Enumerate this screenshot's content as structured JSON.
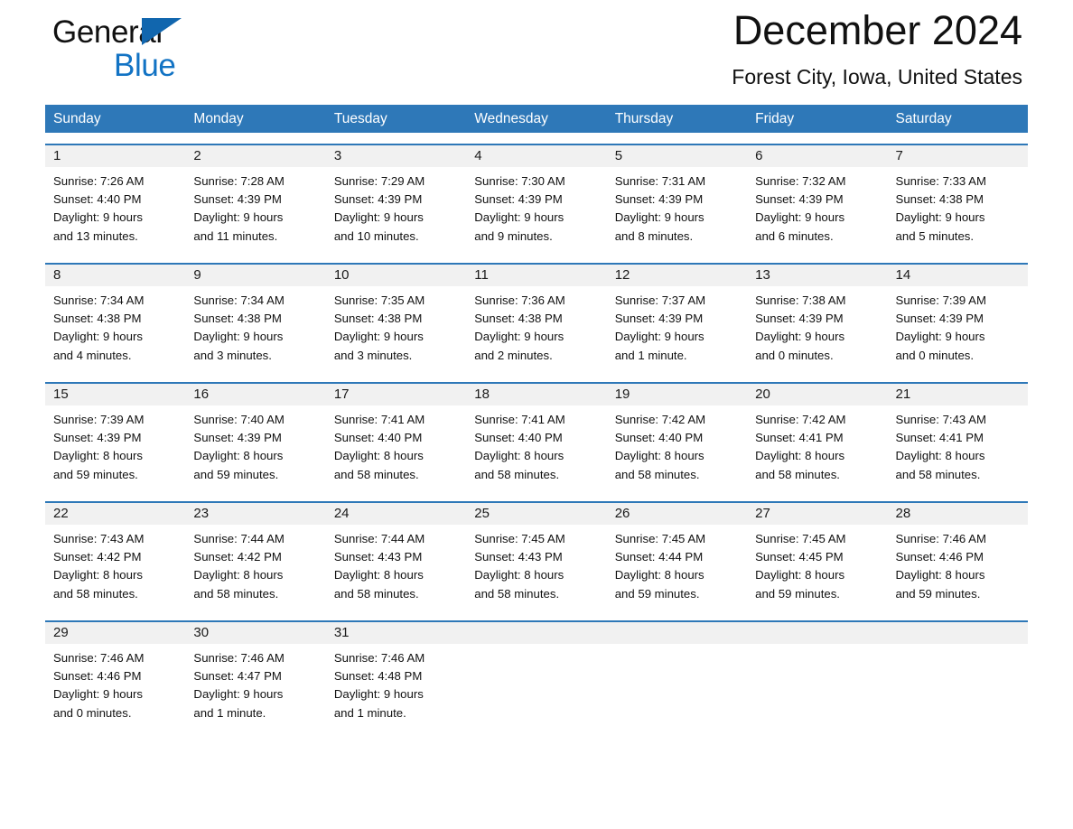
{
  "brand": {
    "line1": "General",
    "line2": "Blue",
    "accent_color": "#1273c4",
    "triangle_color": "#1166ae"
  },
  "header": {
    "title": "December 2024",
    "location": "Forest City, Iowa, United States"
  },
  "theme": {
    "header_blue": "#2e78b8",
    "daynum_band": "#f1f1f1",
    "text": "#111111"
  },
  "calendar": {
    "weekday_headers": [
      "Sunday",
      "Monday",
      "Tuesday",
      "Wednesday",
      "Thursday",
      "Friday",
      "Saturday"
    ],
    "weeks": [
      [
        {
          "day": "1",
          "sunrise": "Sunrise: 7:26 AM",
          "sunset": "Sunset: 4:40 PM",
          "daylight_1": "Daylight: 9 hours",
          "daylight_2": "and 13 minutes."
        },
        {
          "day": "2",
          "sunrise": "Sunrise: 7:28 AM",
          "sunset": "Sunset: 4:39 PM",
          "daylight_1": "Daylight: 9 hours",
          "daylight_2": "and 11 minutes."
        },
        {
          "day": "3",
          "sunrise": "Sunrise: 7:29 AM",
          "sunset": "Sunset: 4:39 PM",
          "daylight_1": "Daylight: 9 hours",
          "daylight_2": "and 10 minutes."
        },
        {
          "day": "4",
          "sunrise": "Sunrise: 7:30 AM",
          "sunset": "Sunset: 4:39 PM",
          "daylight_1": "Daylight: 9 hours",
          "daylight_2": "and 9 minutes."
        },
        {
          "day": "5",
          "sunrise": "Sunrise: 7:31 AM",
          "sunset": "Sunset: 4:39 PM",
          "daylight_1": "Daylight: 9 hours",
          "daylight_2": "and 8 minutes."
        },
        {
          "day": "6",
          "sunrise": "Sunrise: 7:32 AM",
          "sunset": "Sunset: 4:39 PM",
          "daylight_1": "Daylight: 9 hours",
          "daylight_2": "and 6 minutes."
        },
        {
          "day": "7",
          "sunrise": "Sunrise: 7:33 AM",
          "sunset": "Sunset: 4:38 PM",
          "daylight_1": "Daylight: 9 hours",
          "daylight_2": "and 5 minutes."
        }
      ],
      [
        {
          "day": "8",
          "sunrise": "Sunrise: 7:34 AM",
          "sunset": "Sunset: 4:38 PM",
          "daylight_1": "Daylight: 9 hours",
          "daylight_2": "and 4 minutes."
        },
        {
          "day": "9",
          "sunrise": "Sunrise: 7:34 AM",
          "sunset": "Sunset: 4:38 PM",
          "daylight_1": "Daylight: 9 hours",
          "daylight_2": "and 3 minutes."
        },
        {
          "day": "10",
          "sunrise": "Sunrise: 7:35 AM",
          "sunset": "Sunset: 4:38 PM",
          "daylight_1": "Daylight: 9 hours",
          "daylight_2": "and 3 minutes."
        },
        {
          "day": "11",
          "sunrise": "Sunrise: 7:36 AM",
          "sunset": "Sunset: 4:38 PM",
          "daylight_1": "Daylight: 9 hours",
          "daylight_2": "and 2 minutes."
        },
        {
          "day": "12",
          "sunrise": "Sunrise: 7:37 AM",
          "sunset": "Sunset: 4:39 PM",
          "daylight_1": "Daylight: 9 hours",
          "daylight_2": "and 1 minute."
        },
        {
          "day": "13",
          "sunrise": "Sunrise: 7:38 AM",
          "sunset": "Sunset: 4:39 PM",
          "daylight_1": "Daylight: 9 hours",
          "daylight_2": "and 0 minutes."
        },
        {
          "day": "14",
          "sunrise": "Sunrise: 7:39 AM",
          "sunset": "Sunset: 4:39 PM",
          "daylight_1": "Daylight: 9 hours",
          "daylight_2": "and 0 minutes."
        }
      ],
      [
        {
          "day": "15",
          "sunrise": "Sunrise: 7:39 AM",
          "sunset": "Sunset: 4:39 PM",
          "daylight_1": "Daylight: 8 hours",
          "daylight_2": "and 59 minutes."
        },
        {
          "day": "16",
          "sunrise": "Sunrise: 7:40 AM",
          "sunset": "Sunset: 4:39 PM",
          "daylight_1": "Daylight: 8 hours",
          "daylight_2": "and 59 minutes."
        },
        {
          "day": "17",
          "sunrise": "Sunrise: 7:41 AM",
          "sunset": "Sunset: 4:40 PM",
          "daylight_1": "Daylight: 8 hours",
          "daylight_2": "and 58 minutes."
        },
        {
          "day": "18",
          "sunrise": "Sunrise: 7:41 AM",
          "sunset": "Sunset: 4:40 PM",
          "daylight_1": "Daylight: 8 hours",
          "daylight_2": "and 58 minutes."
        },
        {
          "day": "19",
          "sunrise": "Sunrise: 7:42 AM",
          "sunset": "Sunset: 4:40 PM",
          "daylight_1": "Daylight: 8 hours",
          "daylight_2": "and 58 minutes."
        },
        {
          "day": "20",
          "sunrise": "Sunrise: 7:42 AM",
          "sunset": "Sunset: 4:41 PM",
          "daylight_1": "Daylight: 8 hours",
          "daylight_2": "and 58 minutes."
        },
        {
          "day": "21",
          "sunrise": "Sunrise: 7:43 AM",
          "sunset": "Sunset: 4:41 PM",
          "daylight_1": "Daylight: 8 hours",
          "daylight_2": "and 58 minutes."
        }
      ],
      [
        {
          "day": "22",
          "sunrise": "Sunrise: 7:43 AM",
          "sunset": "Sunset: 4:42 PM",
          "daylight_1": "Daylight: 8 hours",
          "daylight_2": "and 58 minutes."
        },
        {
          "day": "23",
          "sunrise": "Sunrise: 7:44 AM",
          "sunset": "Sunset: 4:42 PM",
          "daylight_1": "Daylight: 8 hours",
          "daylight_2": "and 58 minutes."
        },
        {
          "day": "24",
          "sunrise": "Sunrise: 7:44 AM",
          "sunset": "Sunset: 4:43 PM",
          "daylight_1": "Daylight: 8 hours",
          "daylight_2": "and 58 minutes."
        },
        {
          "day": "25",
          "sunrise": "Sunrise: 7:45 AM",
          "sunset": "Sunset: 4:43 PM",
          "daylight_1": "Daylight: 8 hours",
          "daylight_2": "and 58 minutes."
        },
        {
          "day": "26",
          "sunrise": "Sunrise: 7:45 AM",
          "sunset": "Sunset: 4:44 PM",
          "daylight_1": "Daylight: 8 hours",
          "daylight_2": "and 59 minutes."
        },
        {
          "day": "27",
          "sunrise": "Sunrise: 7:45 AM",
          "sunset": "Sunset: 4:45 PM",
          "daylight_1": "Daylight: 8 hours",
          "daylight_2": "and 59 minutes."
        },
        {
          "day": "28",
          "sunrise": "Sunrise: 7:46 AM",
          "sunset": "Sunset: 4:46 PM",
          "daylight_1": "Daylight: 8 hours",
          "daylight_2": "and 59 minutes."
        }
      ],
      [
        {
          "day": "29",
          "sunrise": "Sunrise: 7:46 AM",
          "sunset": "Sunset: 4:46 PM",
          "daylight_1": "Daylight: 9 hours",
          "daylight_2": "and 0 minutes."
        },
        {
          "day": "30",
          "sunrise": "Sunrise: 7:46 AM",
          "sunset": "Sunset: 4:47 PM",
          "daylight_1": "Daylight: 9 hours",
          "daylight_2": "and 1 minute."
        },
        {
          "day": "31",
          "sunrise": "Sunrise: 7:46 AM",
          "sunset": "Sunset: 4:48 PM",
          "daylight_1": "Daylight: 9 hours",
          "daylight_2": "and 1 minute."
        },
        {
          "day": "",
          "sunrise": "",
          "sunset": "",
          "daylight_1": "",
          "daylight_2": ""
        },
        {
          "day": "",
          "sunrise": "",
          "sunset": "",
          "daylight_1": "",
          "daylight_2": ""
        },
        {
          "day": "",
          "sunrise": "",
          "sunset": "",
          "daylight_1": "",
          "daylight_2": ""
        },
        {
          "day": "",
          "sunrise": "",
          "sunset": "",
          "daylight_1": "",
          "daylight_2": ""
        }
      ]
    ]
  }
}
